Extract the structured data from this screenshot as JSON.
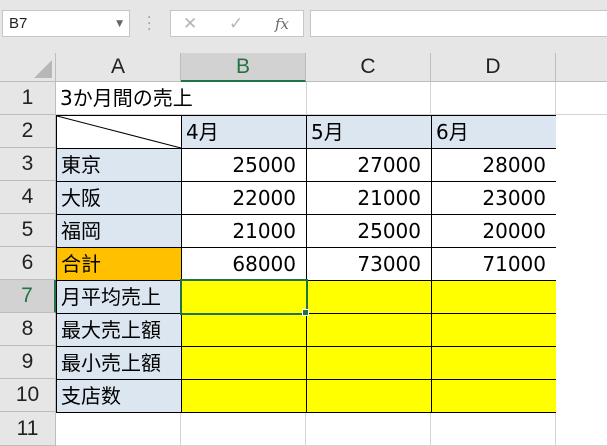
{
  "formula_bar": {
    "name_box": "B7",
    "cancel_glyph": "✕",
    "enter_glyph": "✓",
    "fx_label": "fx",
    "formula_value": ""
  },
  "columns": [
    "A",
    "B",
    "C",
    "D"
  ],
  "rows": [
    "1",
    "2",
    "3",
    "4",
    "5",
    "6",
    "7",
    "8",
    "9",
    "10",
    "11"
  ],
  "cells": {
    "A1": "3か月間の売上",
    "B2": "4月",
    "C2": "5月",
    "D2": "6月",
    "A3": "東京",
    "B3": "25000",
    "C3": "27000",
    "D3": "28000",
    "A4": "大阪",
    "B4": "22000",
    "C4": "21000",
    "D4": "23000",
    "A5": "福岡",
    "B5": "21000",
    "C5": "25000",
    "D5": "20000",
    "A6": "合計",
    "B6": "68000",
    "C6": "73000",
    "D6": "71000",
    "A7": "月平均売上",
    "A8": "最大売上額",
    "A9": "最小売上額",
    "A10": "支店数"
  },
  "selection": {
    "active_cell": "B7",
    "column": "B",
    "row": "7"
  },
  "colors": {
    "header_fill": "#dce6f1",
    "total_fill": "#ffc000",
    "input_fill": "#ffff00",
    "selection": "#217346"
  },
  "icons": {
    "cancel": "close-icon",
    "enter": "check-icon",
    "function": "fx-icon",
    "name_box_dropdown": "chevron-down-icon"
  }
}
